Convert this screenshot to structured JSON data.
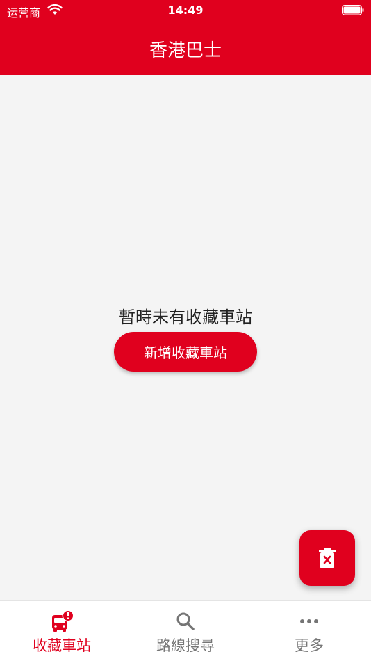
{
  "status_bar": {
    "carrier": "运营商",
    "time": "14:49"
  },
  "header": {
    "title": "香港巴士"
  },
  "empty_state": {
    "message": "暫時未有收藏車站",
    "add_button_label": "新增收藏車站"
  },
  "tabs": [
    {
      "label": "收藏車站",
      "icon": "bus-alert-icon",
      "active": true
    },
    {
      "label": "路線搜尋",
      "icon": "search-icon",
      "active": false
    },
    {
      "label": "更多",
      "icon": "more-dots-icon",
      "active": false
    }
  ],
  "colors": {
    "accent": "#e0001e",
    "background": "#f4f4f4",
    "inactive_tab": "#757575"
  }
}
